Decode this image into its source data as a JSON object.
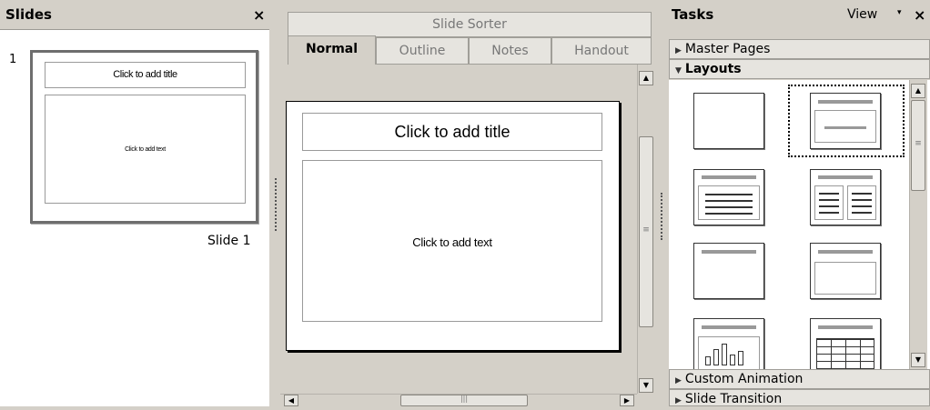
{
  "slides_pane": {
    "title": "Slides",
    "close": "×",
    "slides": [
      {
        "number": "1",
        "label": "Slide 1",
        "title_placeholder": "Click to add title",
        "body_placeholder": "Click to add text"
      }
    ]
  },
  "center": {
    "sorter_tab": "Slide Sorter",
    "tabs": [
      "Normal",
      "Outline",
      "Notes",
      "Handout"
    ],
    "active_tab": "Normal",
    "canvas": {
      "title_placeholder": "Click to add title",
      "body_placeholder": "Click to add text"
    },
    "scroll_grip": "|||"
  },
  "tasks_pane": {
    "title": "Tasks",
    "view_label": "View",
    "view_arrow": "▾",
    "close": "×",
    "sections": [
      {
        "label": "Master Pages",
        "expanded": false
      },
      {
        "label": "Layouts",
        "expanded": true
      },
      {
        "label": "Custom Animation",
        "expanded": false
      },
      {
        "label": "Slide Transition",
        "expanded": false
      }
    ],
    "collapsed_icon": "▶",
    "expanded_icon": "▼"
  },
  "icons": {
    "scroll_up": "▲",
    "scroll_down": "▼",
    "scroll_left": "◀",
    "scroll_right": "▶",
    "grip": "≡"
  }
}
